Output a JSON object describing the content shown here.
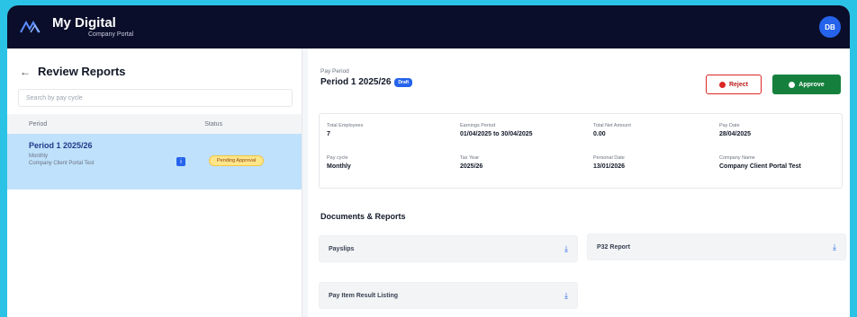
{
  "header": {
    "brand_title": "My Digital",
    "brand_subtitle": "Company Portal",
    "avatar_initials": "DB"
  },
  "sidebar": {
    "back_title": "Review Reports",
    "search_placeholder": "Search by pay cycle",
    "columns": [
      "Period",
      "Status"
    ],
    "rows": [
      {
        "period": "Period 1 2025/26",
        "line1": "Monthly",
        "line2": "Company Client Portal Test",
        "status": "Pending Approval"
      }
    ]
  },
  "main": {
    "pay_label": "Pay Period",
    "pay_title": "Period 1 2025/26",
    "tag": "Draft",
    "reject_label": "Reject",
    "approve_label": "Approve",
    "summary": [
      {
        "k": "Total Employees",
        "v": "7"
      },
      {
        "k": "Earnings Period",
        "v": "01/04/2025 to 30/04/2025"
      },
      {
        "k": "Total Net Amount",
        "v": "0.00"
      },
      {
        "k": "Pay Date",
        "v": "28/04/2025"
      },
      {
        "k": "Pay cycle",
        "v": "Monthly"
      },
      {
        "k": "Tax Year",
        "v": "2025/26"
      },
      {
        "k": "Personal Date",
        "v": "13/01/2026"
      },
      {
        "k": "Company Name",
        "v": "Company Client Portal Test"
      }
    ],
    "documents_title": "Documents & Reports",
    "documents": [
      {
        "label": "Payslips"
      },
      {
        "label": "P32 Report"
      },
      {
        "label": "Pay Item Result Listing"
      }
    ]
  },
  "colors": {
    "topbar": "#0a0e2a",
    "accent": "#2563eb",
    "approve": "#15803d",
    "reject": "#dc2626",
    "selected_row": "#bfe1fb"
  }
}
